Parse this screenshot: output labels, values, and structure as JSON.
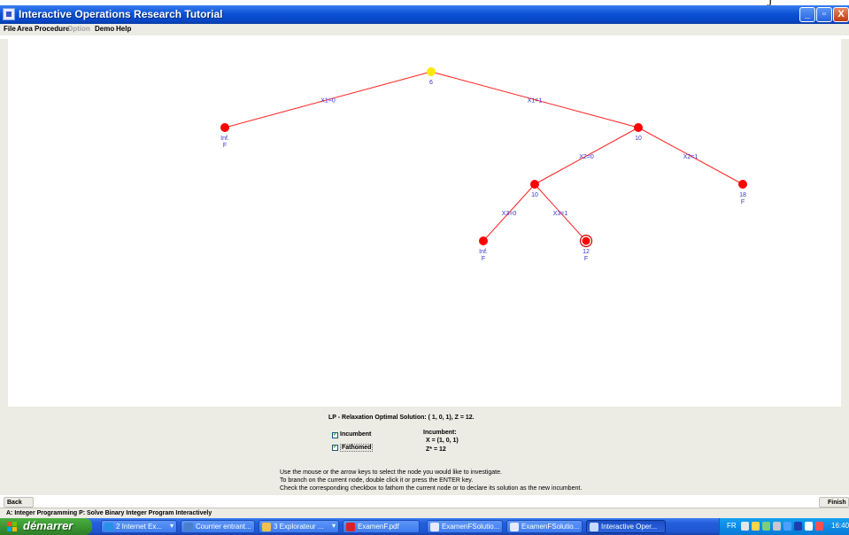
{
  "top_strip": {
    "glyph": "j"
  },
  "window": {
    "title": "Interactive Operations Research Tutorial",
    "controls": {
      "minimize": "_",
      "maximize": "▫",
      "close": "X"
    }
  },
  "menu": {
    "file": "File",
    "area": "Area",
    "procedure": "Procedure",
    "option": "Option",
    "demo": "Demo",
    "help": "Help"
  },
  "tree": {
    "colors": {
      "node": "#ff0000",
      "selected_node": "#ffea00",
      "edge": "#ff2020",
      "label": "#3333cc"
    },
    "nodes": [
      {
        "id": "root",
        "label": "6",
        "sub": "",
        "selected": true
      },
      {
        "id": "x1_0",
        "label": "Inf.",
        "sub": "F"
      },
      {
        "id": "x1_1",
        "label": "10",
        "sub": ""
      },
      {
        "id": "x2_0",
        "label": "10",
        "sub": ""
      },
      {
        "id": "x2_1",
        "label": "18",
        "sub": "F"
      },
      {
        "id": "x3_0",
        "label": "Inf.",
        "sub": "F"
      },
      {
        "id": "x3_1",
        "label": "12",
        "sub": "F",
        "incumbent": true
      }
    ],
    "edges": [
      {
        "from": "root",
        "to": "x1_0",
        "label": "X1=0"
      },
      {
        "from": "root",
        "to": "x1_1",
        "label": "X1=1"
      },
      {
        "from": "x1_1",
        "to": "x2_0",
        "label": "X2=0"
      },
      {
        "from": "x1_1",
        "to": "x2_1",
        "label": "X2=1"
      },
      {
        "from": "x2_0",
        "to": "x3_0",
        "label": "X3=0"
      },
      {
        "from": "x2_0",
        "to": "x3_1",
        "label": "X3=1"
      }
    ]
  },
  "panel": {
    "lp_solution": "LP - Relaxation Optimal Solution: ( 1,  0,  1),  Z = 12.",
    "incumbent_checkbox": {
      "label": "Incumbent",
      "checked": true
    },
    "fathomed_checkbox": {
      "label": "Fathomed",
      "checked": true
    },
    "incumbent_info": {
      "title": "Incumbent:",
      "x": "X  =  (1,  0,  1)",
      "z": "Z* =  12"
    },
    "instructions": [
      "Use the mouse or the arrow keys to select the node you would like to investigate.",
      "To branch on the current node, double click it or press the ENTER key.",
      "Check the corresponding checkbox to fathom the current node or to declare its solution as the new incumbent."
    ],
    "back_label": "Back",
    "finish_label": "Finish"
  },
  "status": {
    "text": "A: Integer Programming  P: Solve Binary Integer Program Interactively"
  },
  "taskbar": {
    "start_label": "démarrer",
    "tasks": [
      {
        "label": "2 Internet Ex...",
        "icon": "internet-explorer-icon",
        "arrow": true
      },
      {
        "label": "Courrier entrant...",
        "icon": "mail-icon",
        "arrow": false
      },
      {
        "label": "3 Explorateur ...",
        "icon": "folder-icon",
        "arrow": true
      },
      {
        "label": "ExamenF.pdf",
        "icon": "pdf-icon",
        "arrow": false
      },
      {
        "label": "ExamenFSolutio...",
        "icon": "document-icon",
        "arrow": false
      },
      {
        "label": "ExamenFSolutio...",
        "icon": "document-icon",
        "arrow": false
      },
      {
        "label": "Interactive Oper...",
        "icon": "java-app-icon",
        "arrow": false,
        "active": true
      }
    ],
    "tray": {
      "language": "FR",
      "time": "16:40"
    }
  }
}
